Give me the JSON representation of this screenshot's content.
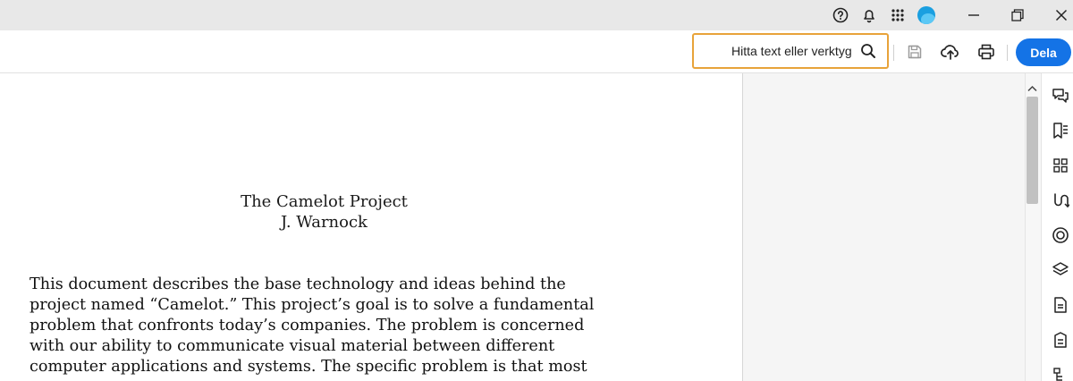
{
  "titlebar": {
    "icons": [
      "help-icon",
      "bell-icon",
      "apps-grid-icon",
      "avatar",
      "minimize-icon",
      "restore-icon",
      "close-icon"
    ]
  },
  "toolbar": {
    "search_placeholder": "Hitta text eller verktyg",
    "share_label": "Dela"
  },
  "document": {
    "title": "The Camelot Project",
    "author": "J. Warnock",
    "body_lines": [
      "This document describes the base technology and ideas behind the",
      "project named “Camelot.” This project’s goal is to solve a fundamental",
      "problem that confronts today’s companies. The problem is concerned",
      "with our ability to communicate visual material between different",
      "computer applications and systems. The specific problem is that most"
    ]
  },
  "colors": {
    "accent": "#1473e6",
    "search_focus": "#e8a33a",
    "titlebar_bg": "#e8e8e8"
  }
}
